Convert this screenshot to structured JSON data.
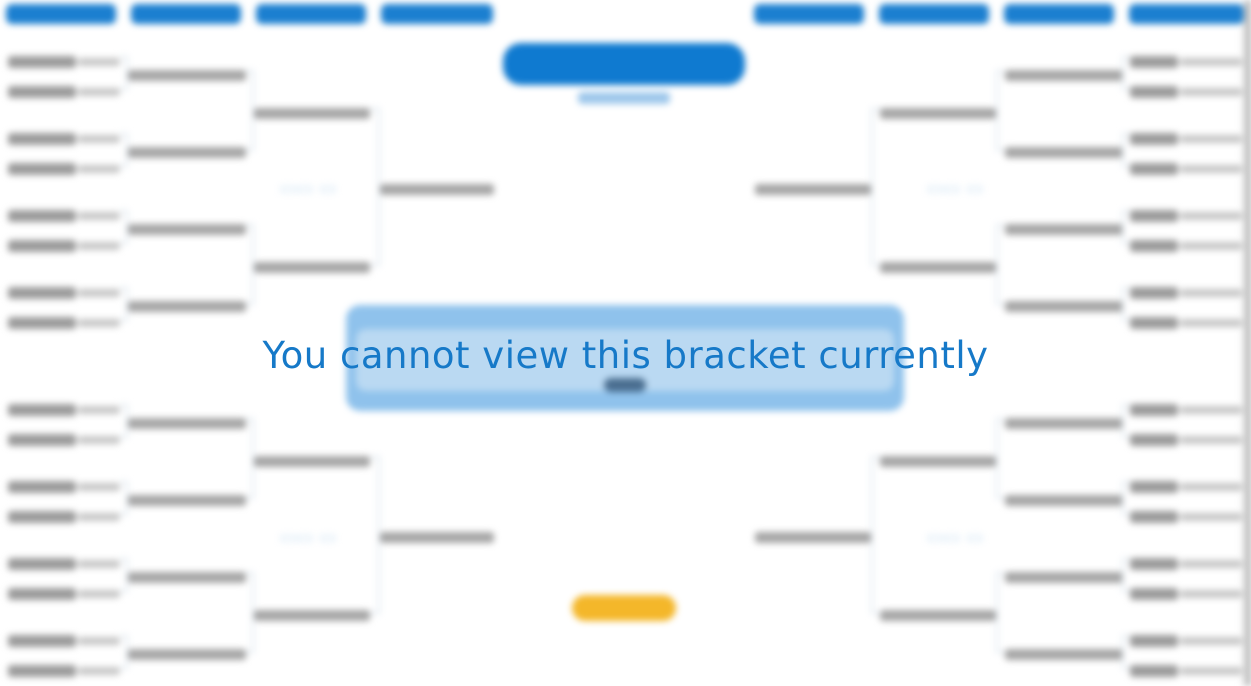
{
  "notice": {
    "message": "You cannot view this bracket currently",
    "color": "#1679c8"
  },
  "bracket": {
    "state": "blurred",
    "accent_color": "#1b7fd0",
    "button_color": "#f4b72a",
    "regions": 4,
    "teams_per_region": 8
  }
}
